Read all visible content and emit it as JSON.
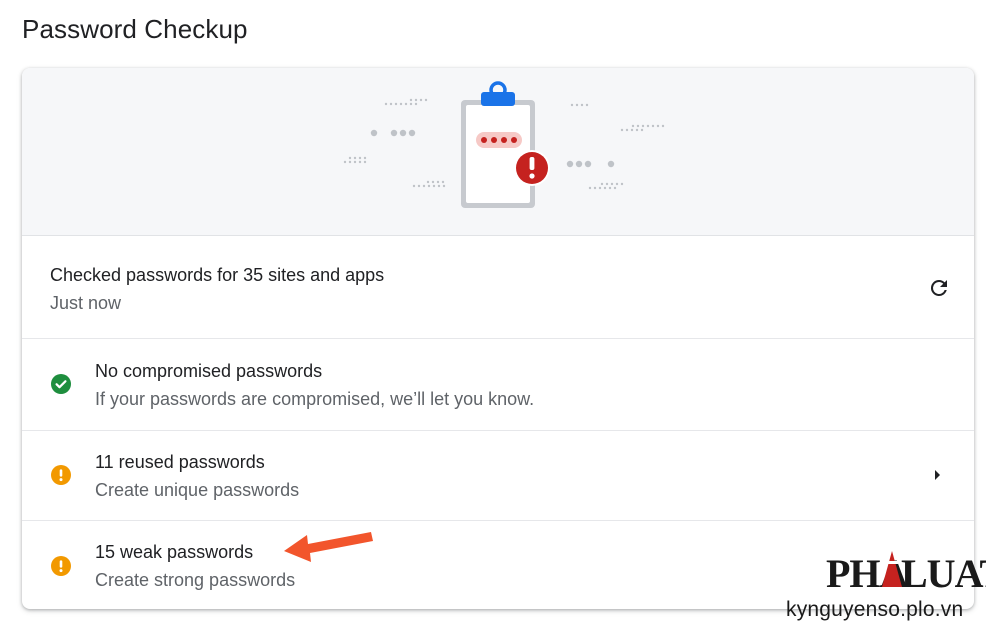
{
  "page": {
    "title": "Password Checkup"
  },
  "summary": {
    "title": "Checked passwords for 35 sites and apps",
    "subtitle": "Just now"
  },
  "compromised": {
    "title": "No compromised passwords",
    "subtitle": "If your passwords are compromised, we’ll let you know."
  },
  "reused": {
    "title": "11 reused passwords",
    "subtitle": "Create unique passwords"
  },
  "weak": {
    "title": "15 weak passwords",
    "subtitle": "Create strong passwords"
  },
  "watermark": {
    "logo_text": "PHAPLUAT",
    "url": "kynguyenso.plo.vn"
  },
  "icons": {
    "refresh": "refresh-icon",
    "safe": "check-circle-icon",
    "warning": "warning-circle-icon",
    "expand": "chevron-right-icon"
  },
  "colors": {
    "safe_green": "#1e8e3e",
    "warning_orange": "#f29900",
    "alert_red": "#c5221f",
    "clipboard_blue": "#1a73e8",
    "annotation_arrow": "#f2552c",
    "hero_background": "#f6f7f9"
  }
}
